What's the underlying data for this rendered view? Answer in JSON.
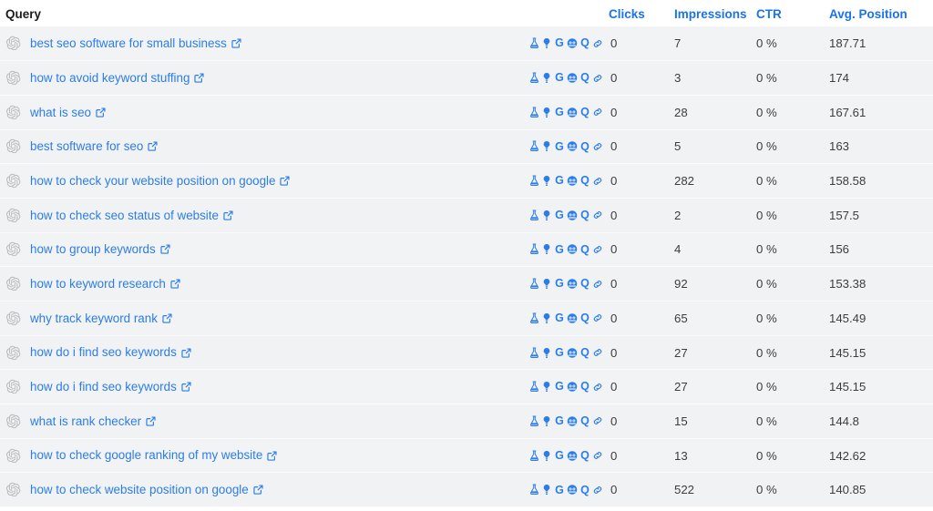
{
  "table": {
    "columns": [
      {
        "key": "query",
        "label": "Query"
      },
      {
        "key": "tools",
        "label": ""
      },
      {
        "key": "clicks",
        "label": "Clicks"
      },
      {
        "key": "impressions",
        "label": "Impressions"
      },
      {
        "key": "ctr",
        "label": "CTR"
      },
      {
        "key": "position",
        "label": "Avg. Position"
      }
    ],
    "row_tools": [
      {
        "name": "flask-icon",
        "glyph": "flask"
      },
      {
        "name": "lightbulb-icon",
        "glyph": "bulb"
      },
      {
        "name": "google-icon",
        "glyph": "G"
      },
      {
        "name": "moz-icon",
        "glyph": "moz"
      },
      {
        "name": "quora-icon",
        "glyph": "Q"
      },
      {
        "name": "link-icon",
        "glyph": "link"
      }
    ],
    "rows": [
      {
        "query": "best seo software for small business",
        "clicks": "0",
        "impressions": "7",
        "ctr": "0 %",
        "position": "187.71"
      },
      {
        "query": "how to avoid keyword stuffing",
        "clicks": "0",
        "impressions": "3",
        "ctr": "0 %",
        "position": "174"
      },
      {
        "query": "what is seo",
        "clicks": "0",
        "impressions": "28",
        "ctr": "0 %",
        "position": "167.61"
      },
      {
        "query": "best software for seo",
        "clicks": "0",
        "impressions": "5",
        "ctr": "0 %",
        "position": "163"
      },
      {
        "query": "how to check your website position on google",
        "clicks": "0",
        "impressions": "282",
        "ctr": "0 %",
        "position": "158.58"
      },
      {
        "query": "how to check seo status of website",
        "clicks": "0",
        "impressions": "2",
        "ctr": "0 %",
        "position": "157.5"
      },
      {
        "query": "how to group keywords",
        "clicks": "0",
        "impressions": "4",
        "ctr": "0 %",
        "position": "156"
      },
      {
        "query": "how to keyword research",
        "clicks": "0",
        "impressions": "92",
        "ctr": "0 %",
        "position": "153.38"
      },
      {
        "query": "why track keyword rank",
        "clicks": "0",
        "impressions": "65",
        "ctr": "0 %",
        "position": "145.49"
      },
      {
        "query": "how do i find seo keywords",
        "clicks": "0",
        "impressions": "27",
        "ctr": "0 %",
        "position": "145.15"
      },
      {
        "query": "how do i find seo keywords",
        "clicks": "0",
        "impressions": "27",
        "ctr": "0 %",
        "position": "145.15"
      },
      {
        "query": "what is rank checker",
        "clicks": "0",
        "impressions": "15",
        "ctr": "0 %",
        "position": "144.8"
      },
      {
        "query": "how to check google ranking of my website",
        "clicks": "0",
        "impressions": "13",
        "ctr": "0 %",
        "position": "142.62"
      },
      {
        "query": "how to check website position on google",
        "clicks": "0",
        "impressions": "522",
        "ctr": "0 %",
        "position": "140.85"
      }
    ]
  },
  "colors": {
    "link_blue": "#2b7de9",
    "header_blue": "#1a73e8",
    "row_bg": "#f2f3f5",
    "header_bg": "#ffffff",
    "text": "#3c3c41"
  }
}
